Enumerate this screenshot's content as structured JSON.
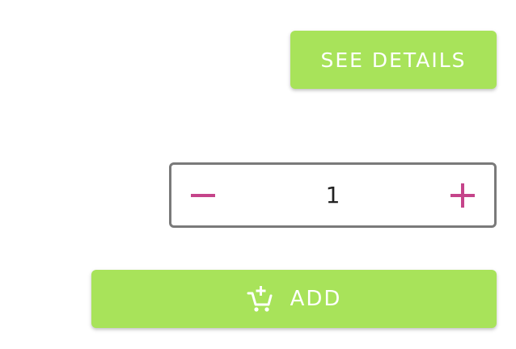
{
  "details_button": {
    "label": "SEE DETAILS"
  },
  "quantity_stepper": {
    "value": "1",
    "decrement_icon": "minus-icon",
    "increment_icon": "plus-icon"
  },
  "add_button": {
    "label": "ADD",
    "icon": "add-to-cart-icon"
  },
  "colors": {
    "accent_green": "#a8e35a",
    "stepper_icon": "#c5448a",
    "border": "#7a7a7a"
  }
}
